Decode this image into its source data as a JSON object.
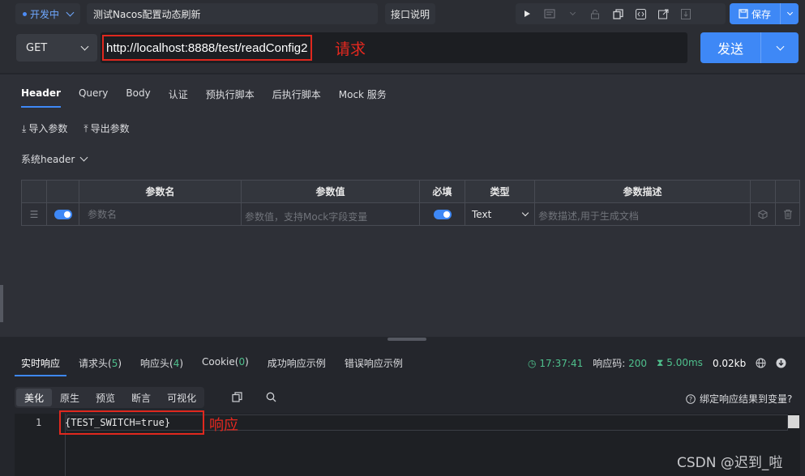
{
  "topbar": {
    "env_label": "开发中",
    "api_name": "测试Nacos配置动态刷新",
    "doc_button": "接口说明",
    "save_label": "保存",
    "tools": [
      "play-icon",
      "doc-icon",
      "lock-icon",
      "copy-icon",
      "code-icon",
      "share-icon",
      "export-icon"
    ]
  },
  "request": {
    "method": "GET",
    "url": "http://localhost:8888/test/readConfig2",
    "url_annotation": "请求",
    "send_label": "发送"
  },
  "req_tabs": [
    "Header",
    "Query",
    "Body",
    "认证",
    "预执行脚本",
    "后执行脚本",
    "Mock 服务"
  ],
  "params_actions": {
    "import": "导入参数",
    "export": "导出参数"
  },
  "system_header": "系统header",
  "params_table": {
    "columns": [
      "参数名",
      "参数值",
      "必填",
      "类型",
      "参数描述"
    ],
    "row": {
      "name_placeholder": "参数名",
      "value_placeholder": "参数值，支持Mock字段变量",
      "type": "Text",
      "desc_placeholder": "参数描述,用于生成文档"
    }
  },
  "response": {
    "tabs": [
      {
        "label": "实时响应",
        "count": ""
      },
      {
        "label": "请求头(",
        "count": "5",
        "suffix": ")"
      },
      {
        "label": "响应头(",
        "count": "4",
        "suffix": ")"
      },
      {
        "label": "Cookie(",
        "count": "0",
        "suffix": ")"
      },
      {
        "label": "成功响应示例",
        "count": ""
      },
      {
        "label": "错误响应示例",
        "count": ""
      }
    ],
    "time": "17:37:41",
    "code_label": "响应码:",
    "code": "200",
    "duration": "5.00ms",
    "size": "0.02kb",
    "format_buttons": [
      "美化",
      "原生",
      "预览",
      "断言",
      "可视化"
    ],
    "bind_label": "绑定响应结果到变量?",
    "line_number": "1",
    "body": "{TEST_SWITCH=true}",
    "body_annotation": "响应"
  },
  "watermark": "CSDN @迟到_啦",
  "colors": {
    "accent": "#3e88f6",
    "annotation": "#e0281e",
    "success": "#4fc08d"
  }
}
